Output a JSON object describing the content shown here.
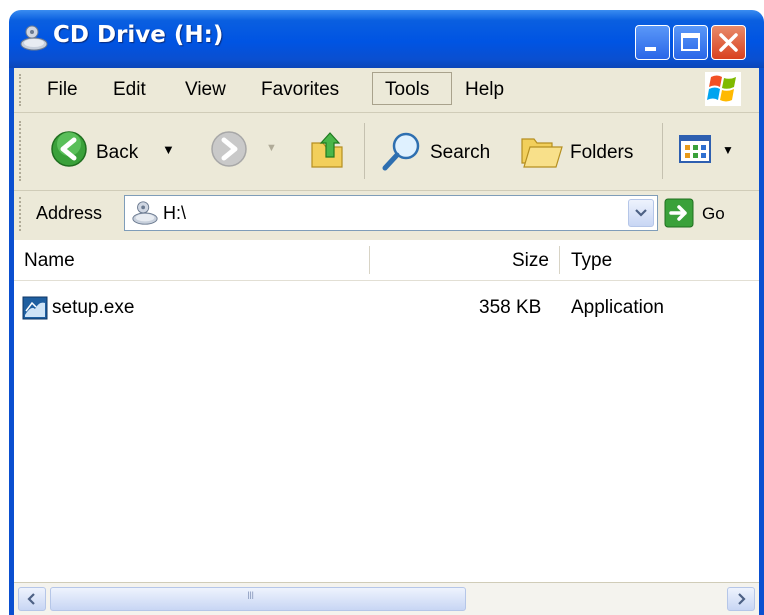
{
  "window": {
    "title": "CD Drive (H:)"
  },
  "menu": {
    "items": [
      "File",
      "Edit",
      "View",
      "Favorites",
      "Tools",
      "Help"
    ]
  },
  "toolbar": {
    "back_label": "Back",
    "search_label": "Search",
    "folders_label": "Folders"
  },
  "address": {
    "label": "Address",
    "value": "H:\\",
    "go_label": "Go"
  },
  "columns": {
    "name": "Name",
    "size": "Size",
    "type": "Type"
  },
  "files": [
    {
      "name": "setup.exe",
      "size": "358 KB",
      "type": "Application"
    }
  ],
  "scrollbar": {
    "grip": "III"
  }
}
